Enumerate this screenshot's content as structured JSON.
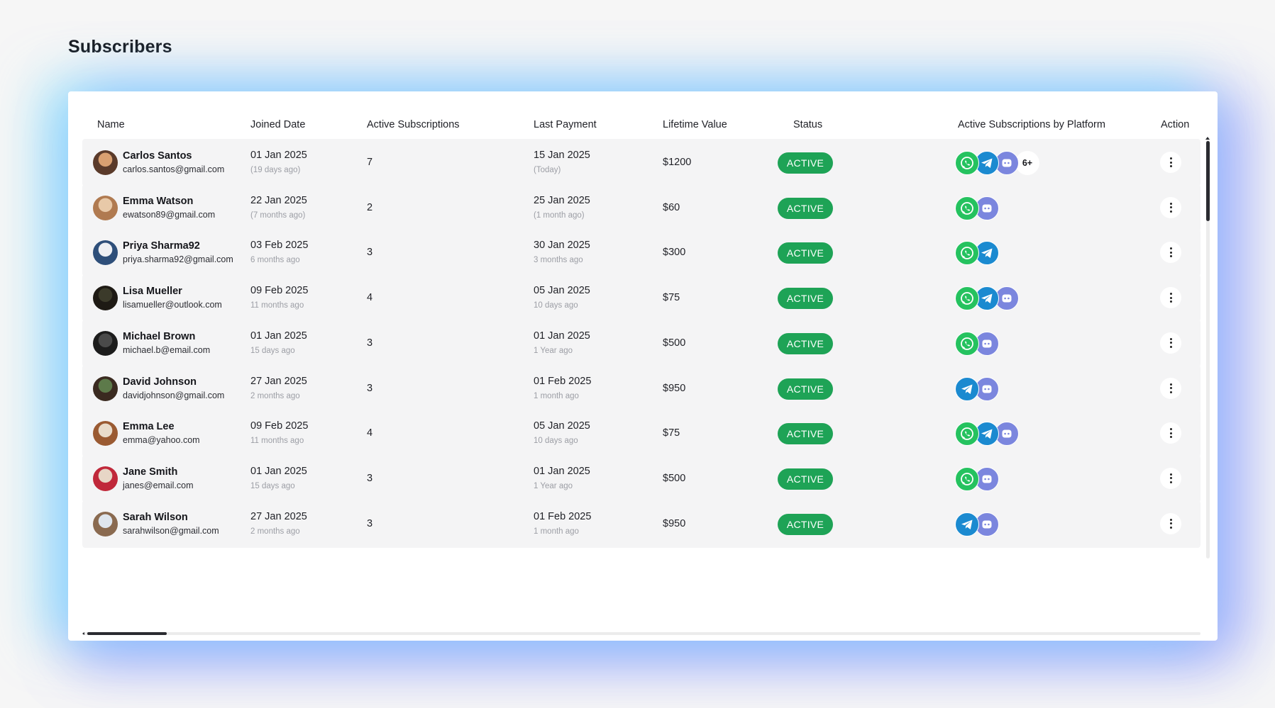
{
  "page": {
    "title": "Subscribers"
  },
  "table": {
    "headers": {
      "name": "Name",
      "joined_date": "Joined Date",
      "active_subscriptions": "Active Subscriptions",
      "last_payment": "Last Payment",
      "lifetime_value": "Lifetime Value",
      "status": "Status",
      "platforms": "Active Subscriptions by Platform",
      "action": "Action"
    },
    "rows": [
      {
        "name": "Carlos Santos",
        "email": "carlos.santos@gmail.com",
        "joined": "01 Jan 2025",
        "joined_ago": "(19 days ago)",
        "subs": "7",
        "last_payment": "15 Jan 2025",
        "last_payment_ago": "(Today)",
        "ltv": "$1200",
        "status": "ACTIVE",
        "platforms": [
          "whatsapp",
          "telegram",
          "discord"
        ],
        "more": "6+",
        "avatar_colors": [
          "#d9a071",
          "#5a3a2a"
        ]
      },
      {
        "name": "Emma  Watson",
        "email": "ewatson89@gmail.com",
        "joined": "22 Jan 2025",
        "joined_ago": "(7 months ago)",
        "subs": "2",
        "last_payment": "25 Jan  2025",
        "last_payment_ago": "(1 month ago)",
        "ltv": "$60",
        "status": "ACTIVE",
        "platforms": [
          "whatsapp",
          "discord"
        ],
        "avatar_colors": [
          "#e8c9a8",
          "#b07a50"
        ]
      },
      {
        "name": "Priya Sharma92",
        "email": "priya.sharma92@gmail.com",
        "joined": "03 Feb 2025",
        "joined_ago": "6 months ago",
        "subs": "3",
        "last_payment": "30 Jan 2025",
        "last_payment_ago": "3 months ago",
        "ltv": "$300",
        "status": "ACTIVE",
        "platforms": [
          "whatsapp",
          "telegram"
        ],
        "avatar_colors": [
          "#eef0f4",
          "#2e4f7a"
        ]
      },
      {
        "name": "Lisa Mueller",
        "email": "lisamueller@outlook.com",
        "joined": "09 Feb 2025",
        "joined_ago": "11 months ago",
        "subs": "4",
        "last_payment": "05 Jan 2025",
        "last_payment_ago": "10 days ago",
        "ltv": "$75",
        "status": "ACTIVE",
        "platforms": [
          "whatsapp",
          "telegram",
          "discord"
        ],
        "avatar_colors": [
          "#3b3a2a",
          "#1e1a14"
        ]
      },
      {
        "name": "Michael Brown",
        "email": "michael.b@email.com",
        "joined": "01 Jan 2025",
        "joined_ago": "15 days ago",
        "subs": "3",
        "last_payment": "01 Jan 2025",
        "last_payment_ago": "1 Year ago",
        "ltv": "$500",
        "status": "ACTIVE",
        "platforms": [
          "whatsapp",
          "discord"
        ],
        "avatar_colors": [
          "#4a4a4a",
          "#1c1c1c"
        ]
      },
      {
        "name": "David Johnson",
        "email": "davidjohnson@gmail.com",
        "joined": "27 Jan 2025",
        "joined_ago": "2 months ago",
        "subs": "3",
        "last_payment": "01 Feb 2025",
        "last_payment_ago": "1 month ago",
        "ltv": "$950",
        "status": "ACTIVE",
        "platforms": [
          "telegram",
          "discord"
        ],
        "avatar_colors": [
          "#5d7a4a",
          "#3a2a20"
        ]
      },
      {
        "name": "Emma Lee",
        "email": "emma@yahoo.com",
        "joined": "09 Feb 2025",
        "joined_ago": "11 months ago",
        "subs": "4",
        "last_payment": "05 Jan 2025",
        "last_payment_ago": "10 days ago",
        "ltv": "$75",
        "status": "ACTIVE",
        "platforms": [
          "whatsapp",
          "telegram",
          "discord"
        ],
        "avatar_colors": [
          "#e9dccb",
          "#9a5a32"
        ]
      },
      {
        "name": "Jane Smith",
        "email": "janes@email.com",
        "joined": "01 Jan 2025",
        "joined_ago": "15 days ago",
        "subs": "3",
        "last_payment": "01 Jan 2025",
        "last_payment_ago": "1 Year ago",
        "ltv": "$500",
        "status": "ACTIVE",
        "platforms": [
          "whatsapp",
          "discord"
        ],
        "avatar_colors": [
          "#e7d6c6",
          "#c0283a"
        ]
      },
      {
        "name": "Sarah Wilson",
        "email": "sarahwilson@gmail.com",
        "joined": "27 Jan 2025",
        "joined_ago": "2 months ago",
        "subs": "3",
        "last_payment": "01 Feb 2025",
        "last_payment_ago": "1 month ago",
        "ltv": "$950",
        "status": "ACTIVE",
        "platforms": [
          "telegram",
          "discord"
        ],
        "avatar_colors": [
          "#dfe6ee",
          "#8a6a50"
        ]
      }
    ]
  },
  "icons": {
    "whatsapp": "whatsapp-icon",
    "telegram": "telegram-icon",
    "discord": "discord-icon",
    "more": "more-vertical-icon"
  },
  "colors": {
    "status_active": "#1ea356",
    "whatsapp": "#25c25f",
    "telegram": "#1b8ad0",
    "discord": "#7b86de"
  }
}
